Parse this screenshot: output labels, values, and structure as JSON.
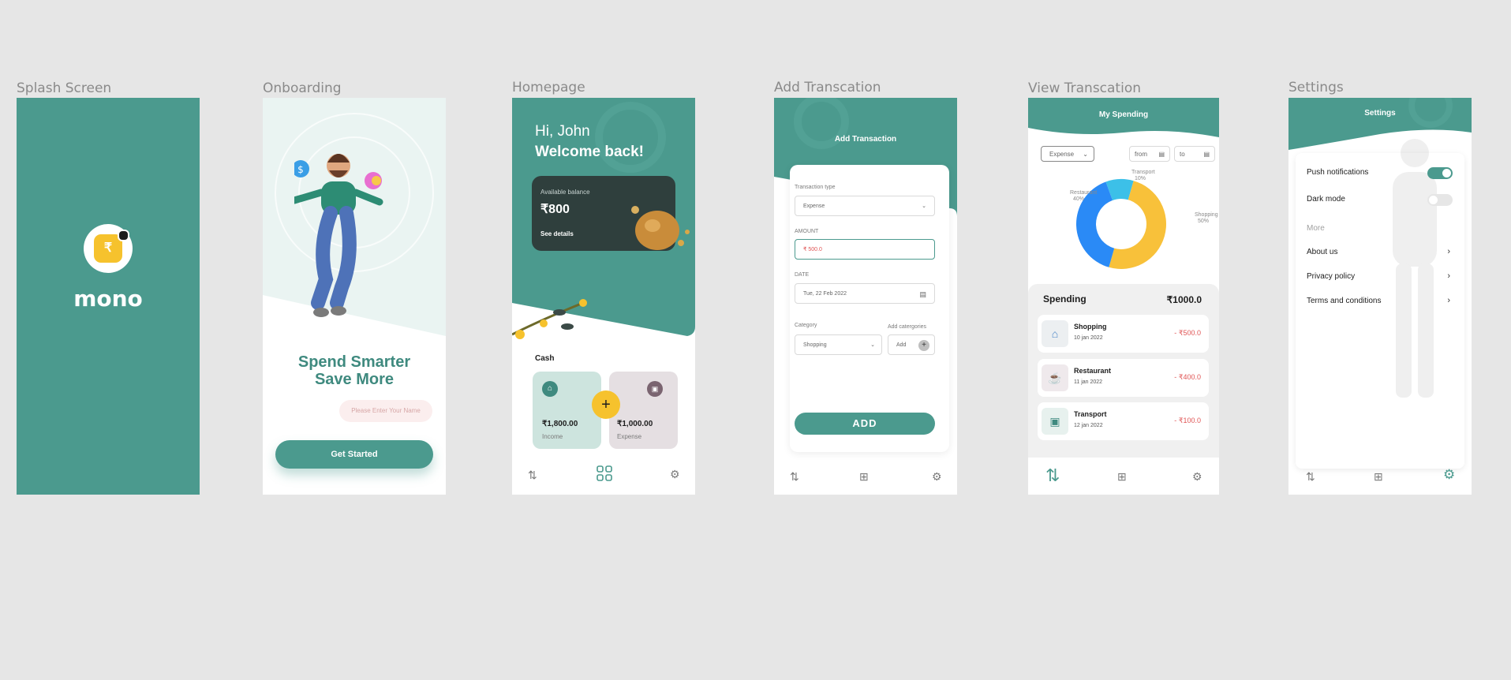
{
  "frames": {
    "splash": "Splash Screen",
    "onboarding": "Onboarding",
    "homepage": "Homepage",
    "add": "Add Transcation",
    "view": "View Transcation",
    "settings": "Settings"
  },
  "splash": {
    "logo_glyph": "₹",
    "brand": "mono"
  },
  "onboarding": {
    "title_line1": "Spend Smarter",
    "title_line2": "Save More",
    "name_placeholder": "Please Enter Your Name",
    "cta": "Get Started"
  },
  "home": {
    "greeting": "Hi, John",
    "welcome": "Welcome back!",
    "balance_label": "Available balance",
    "balance_value": "₹800",
    "see_details": "See details",
    "cash_label": "Cash",
    "income_value": "₹1,800.00",
    "income_label": "Income",
    "expense_value": "₹1,000.00",
    "expense_label": "Expense",
    "add_glyph": "+"
  },
  "add_txn": {
    "title": "Add  Transaction",
    "type_label": "Transaction type",
    "type_value": "Expense",
    "amount_label": "AMOUNT",
    "amount_value": "₹ 500.0",
    "date_label": "DATE",
    "date_value": "Tue, 22 Feb 2022",
    "category_label": "Category",
    "category_value": "Shopping",
    "add_categories_label": "Add catergories",
    "add_category_placeholder": "Add",
    "submit": "ADD"
  },
  "view_txn": {
    "title": "My Spending",
    "filter": "Expense",
    "from": "from",
    "to": "to",
    "spending_label": "Spending",
    "spending_total": "₹1000.0",
    "transactions": [
      {
        "title": "Shopping",
        "date": "10 jan 2022",
        "amount": "- ₹500.0",
        "icon": "store-icon"
      },
      {
        "title": "Restaurant",
        "date": "11 jan 2022",
        "amount": "- ₹400.0",
        "icon": "coffee-icon"
      },
      {
        "title": "Transport",
        "date": "12 jan 2022",
        "amount": "- ₹100.0",
        "icon": "bus-icon"
      }
    ]
  },
  "chart_data": {
    "type": "pie",
    "categories": [
      "Shopping",
      "Restaurant",
      "Transport"
    ],
    "values": [
      50,
      40,
      10
    ],
    "labels": [
      "Shopping\n50%",
      "Restaurant\n40%",
      "Transport\n10%"
    ],
    "colors": [
      "#f8c13a",
      "#2a8af6",
      "#3cc0e8"
    ]
  },
  "settings": {
    "title": "Settings",
    "push": "Push notifications",
    "push_on": true,
    "dark": "Dark mode",
    "dark_on": false,
    "more": "More",
    "about": "About us",
    "privacy": "Privacy policy",
    "terms": "Terms and conditions"
  },
  "colors": {
    "teal": "#4b9a8e",
    "yellow": "#f6c22d",
    "negative": "#e05555"
  }
}
